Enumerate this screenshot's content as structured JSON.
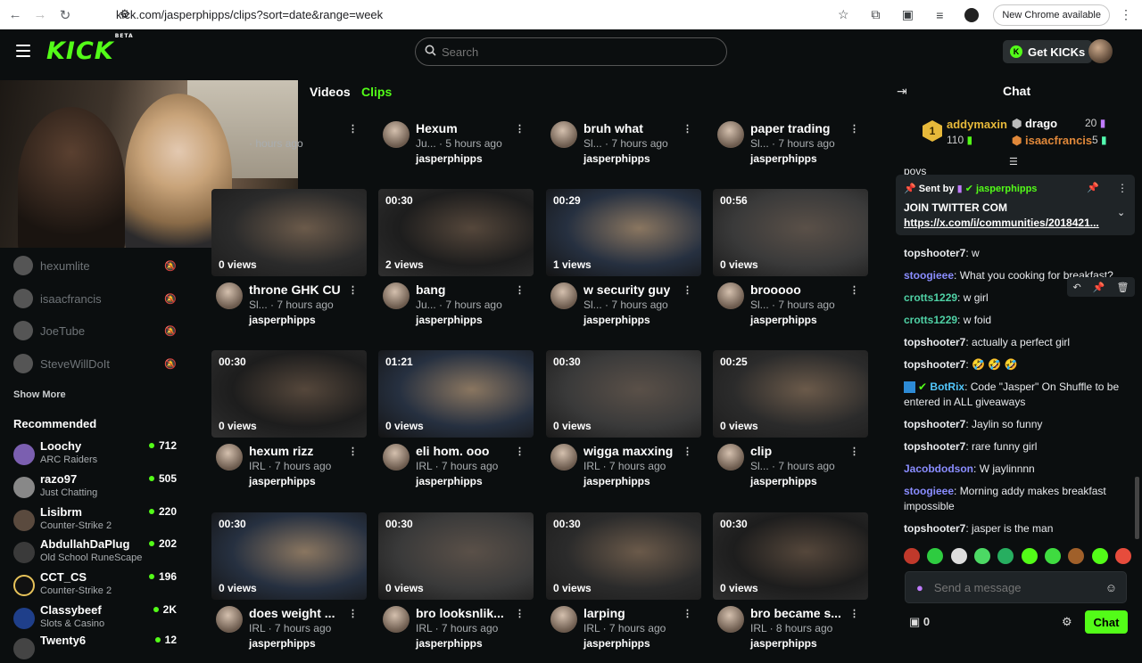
{
  "browser": {
    "url": "kick.com/jasperphipps/clips?sort=date&range=week",
    "new_chrome": "New Chrome available"
  },
  "header": {
    "logo": "KICK",
    "logo_badge": "BETA",
    "search_placeholder": "Search",
    "get_kicks": "Get KICKs"
  },
  "tabs": {
    "videos": "Videos",
    "clips": "Clips"
  },
  "sidebar": {
    "following": [
      {
        "name": "hexumlite"
      },
      {
        "name": "isaacfrancis"
      },
      {
        "name": "JoeTube"
      },
      {
        "name": "SteveWillDoIt"
      }
    ],
    "show_more": "Show More",
    "recommended_title": "Recommended",
    "recommended": [
      {
        "name": "Loochy",
        "game": "ARC Raiders",
        "viewers": "712"
      },
      {
        "name": "razo97",
        "game": "Just Chatting",
        "viewers": "505"
      },
      {
        "name": "Lisibrm",
        "game": "Counter-Strike 2",
        "viewers": "220"
      },
      {
        "name": "AbdullahDaPlug",
        "game": "Old School RuneScape",
        "viewers": "202"
      },
      {
        "name": "CCT_CS",
        "game": "Counter-Strike 2",
        "viewers": "196"
      },
      {
        "name": "Classybeef",
        "game": "Slots & Casino",
        "viewers": "2K"
      },
      {
        "name": "Twenty6",
        "game": "",
        "viewers": "12"
      }
    ]
  },
  "clips": [
    {
      "title": "",
      "category": "",
      "age": "hours ago",
      "user": "",
      "duration": "",
      "views": ""
    },
    {
      "title": "Hexum",
      "category": "Ju...",
      "age": "5 hours ago",
      "user": "jasperphipps",
      "duration": "",
      "views": ""
    },
    {
      "title": "bruh what",
      "category": "Sl...",
      "age": "7 hours ago",
      "user": "jasperphipps",
      "duration": "",
      "views": ""
    },
    {
      "title": "paper trading",
      "category": "Sl...",
      "age": "7 hours ago",
      "user": "jasperphipps",
      "duration": "",
      "views": ""
    },
    {
      "title": "throne GHK CU",
      "category": "Sl...",
      "age": "7 hours ago",
      "user": "jasperphipps",
      "duration": "",
      "views": "0 views"
    },
    {
      "title": "bang",
      "category": "Ju...",
      "age": "7 hours ago",
      "user": "jasperphipps",
      "duration": "00:30",
      "views": "2 views"
    },
    {
      "title": "w security guy",
      "category": "Sl...",
      "age": "7 hours ago",
      "user": "jasperphipps",
      "duration": "00:29",
      "views": "1 views"
    },
    {
      "title": "brooooo",
      "category": "Sl...",
      "age": "7 hours ago",
      "user": "jasperphipps",
      "duration": "00:56",
      "views": "0 views"
    },
    {
      "title": "hexum rizz",
      "category": "IRL",
      "age": "7 hours ago",
      "user": "jasperphipps",
      "duration": "00:30",
      "views": "0 views"
    },
    {
      "title": "eli hom. ooo",
      "category": "IRL",
      "age": "7 hours ago",
      "user": "jasperphipps",
      "duration": "01:21",
      "views": "0 views"
    },
    {
      "title": "wigga maxxing",
      "category": "IRL",
      "age": "7 hours ago",
      "user": "jasperphipps",
      "duration": "00:30",
      "views": "0 views"
    },
    {
      "title": "clip",
      "category": "Sl...",
      "age": "7 hours ago",
      "user": "jasperphipps",
      "duration": "00:25",
      "views": "0 views"
    },
    {
      "title": "does weight ...",
      "category": "IRL",
      "age": "7 hours ago",
      "user": "jasperphipps",
      "duration": "00:30",
      "views": "0 views"
    },
    {
      "title": "bro looksnlik...",
      "category": "IRL",
      "age": "7 hours ago",
      "user": "jasperphipps",
      "duration": "00:30",
      "views": "0 views"
    },
    {
      "title": "larping",
      "category": "IRL",
      "age": "7 hours ago",
      "user": "jasperphipps",
      "duration": "00:30",
      "views": "0 views"
    },
    {
      "title": "bro became s...",
      "category": "IRL",
      "age": "8 hours ago",
      "user": "jasperphipps",
      "duration": "00:30",
      "views": "0 views"
    }
  ],
  "chat": {
    "title": "Chat",
    "leaderboard": [
      {
        "rank": "1",
        "name": "addymaxin",
        "count": "110"
      },
      {
        "name": "drago",
        "count": "20"
      },
      {
        "name": "isaacfrancis",
        "count": "5"
      }
    ],
    "partial_msg": "povs",
    "pinned": {
      "sent_by_label": "Sent by",
      "sender": "jasperphipps",
      "message": "JOIN TWITTER COM",
      "link": "https://x.com/i/communities/2018421..."
    },
    "messages": [
      {
        "user": "topshooter7",
        "text": "w",
        "color": "#e8eaed"
      },
      {
        "user": "stoogieee",
        "text": "What you cooking for breakfast?",
        "color": "#8a8dff"
      },
      {
        "user": "crotts1229",
        "text": "w girl",
        "color": "#4fd1a5"
      },
      {
        "user": "crotts1229",
        "text": "w foid",
        "color": "#4fd1a5"
      },
      {
        "user": "topshooter7",
        "text": "actually a perfect girl",
        "color": "#e8eaed"
      },
      {
        "user": "topshooter7",
        "text": "🤣 🤣 🤣",
        "color": "#e8eaed"
      },
      {
        "user": "BotRix",
        "text": "Code \"Jasper\" On Shuffle to be entered in ALL giveaways",
        "color": "#53c7fc"
      },
      {
        "user": "topshooter7",
        "text": "Jaylin so funny",
        "color": "#e8eaed"
      },
      {
        "user": "topshooter7",
        "text": "rare funny girl",
        "color": "#e8eaed"
      },
      {
        "user": "Jacobdodson",
        "text": "W jaylinnnn",
        "color": "#8a8dff"
      },
      {
        "user": "stoogieee",
        "text": "Morning addy makes breakfast impossible",
        "color": "#8a8dff"
      },
      {
        "user": "topshooter7",
        "text": "jasper is the man",
        "color": "#e8eaed"
      }
    ],
    "send_placeholder": "Send a message",
    "kicks_count": "0",
    "chat_button": "Chat"
  }
}
